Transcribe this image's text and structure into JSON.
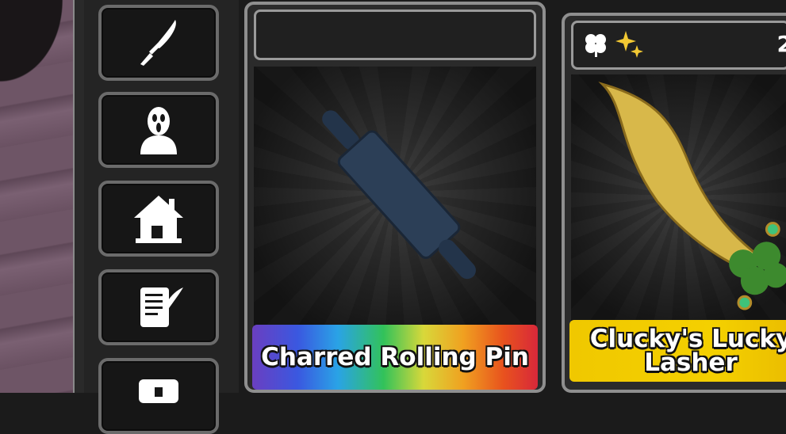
{
  "sidebar": {
    "buttons": [
      {
        "icon": "knife-icon"
      },
      {
        "icon": "ghostface-icon"
      },
      {
        "icon": "house-icon"
      },
      {
        "icon": "scroll-quill-icon"
      },
      {
        "icon": "chest-icon"
      }
    ]
  },
  "cards": [
    {
      "name": "Charred Rolling Pin",
      "rarity_style": "rainbow"
    },
    {
      "name": "Clucky's Lucky Lasher",
      "rarity_style": "gold",
      "badges": [
        "clover-icon",
        "sparkle-icon"
      ],
      "count": "2"
    }
  ]
}
